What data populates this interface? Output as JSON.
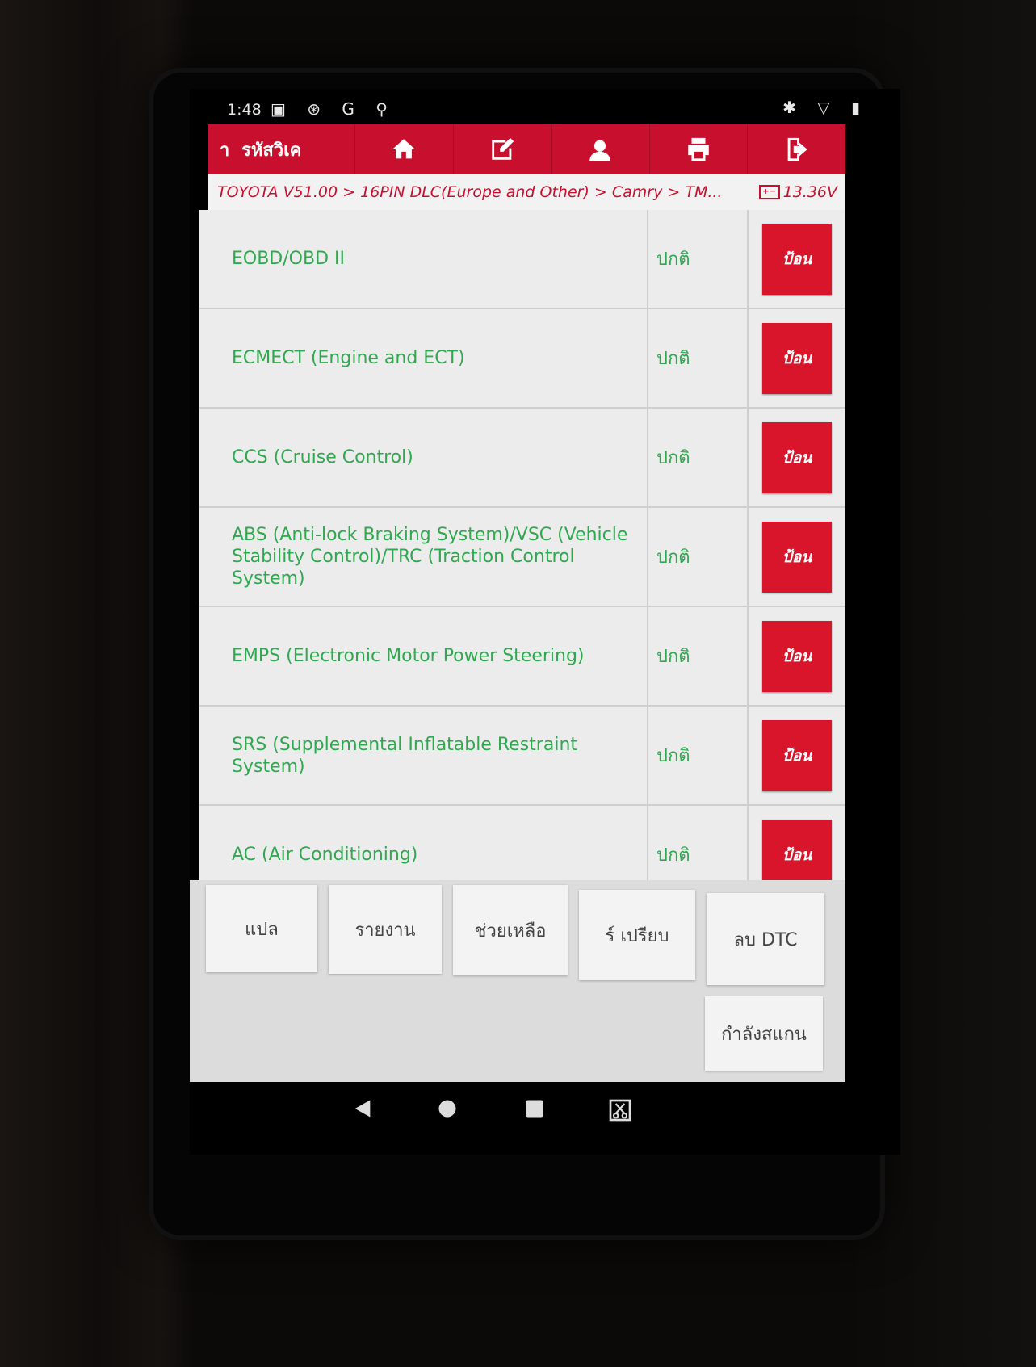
{
  "status_bar": {
    "time": "1:48",
    "left_icons": [
      "photo-icon",
      "sync-icon",
      "google-icon",
      "stethoscope-icon"
    ],
    "left_glyphs": "▣ ⊛ G ⚲",
    "right_glyphs": "✱ ▽ ▮"
  },
  "header": {
    "back_label": "า",
    "title": "รหัสวิเค",
    "buttons": [
      "home-icon",
      "edit-icon",
      "support-icon",
      "print-icon",
      "exit-icon"
    ]
  },
  "breadcrumb": {
    "path": "TOYOTA V51.00 > 16PIN DLC(Europe and Other) > Camry > TM...",
    "voltage": "13.36V"
  },
  "systems": [
    {
      "name": "EOBD/OBD II",
      "status": "ปกติ",
      "action": "ป้อน"
    },
    {
      "name": "ECMECT (Engine and ECT)",
      "status": "ปกติ",
      "action": "ป้อน"
    },
    {
      "name": "CCS (Cruise Control)",
      "status": "ปกติ",
      "action": "ป้อน"
    },
    {
      "name": "ABS (Anti-lock Braking System)/VSC (Vehicle Stability Control)/TRC (Traction Control System)",
      "status": "ปกติ",
      "action": "ป้อน"
    },
    {
      "name": "EMPS (Electronic Motor Power Steering)",
      "status": "ปกติ",
      "action": "ป้อน"
    },
    {
      "name": "SRS (Supplemental Inflatable Restraint System)",
      "status": "ปกติ",
      "action": "ป้อน"
    },
    {
      "name": "AC (Air Conditioning)",
      "status": "ปกติ",
      "action": "ป้อน"
    }
  ],
  "bottom_buttons": {
    "translate": "แปล",
    "report": "รายงาน",
    "help": "ช่วยเหลือ",
    "compare": "ร์   เปรียบ",
    "clear_dtc": "ลบ DTC",
    "scanning": "กำลังสแกน"
  },
  "colors": {
    "brand_red": "#c8102e",
    "status_green": "#2fa84f"
  }
}
